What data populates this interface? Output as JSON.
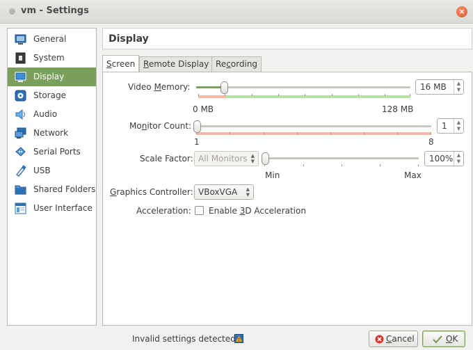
{
  "window": {
    "title": "vm - Settings"
  },
  "sidebar": {
    "items": [
      {
        "label": "General",
        "icon": "general-icon"
      },
      {
        "label": "System",
        "icon": "system-icon"
      },
      {
        "label": "Display",
        "icon": "display-icon",
        "selected": true
      },
      {
        "label": "Storage",
        "icon": "storage-icon"
      },
      {
        "label": "Audio",
        "icon": "audio-icon"
      },
      {
        "label": "Network",
        "icon": "network-icon"
      },
      {
        "label": "Serial Ports",
        "icon": "serial-ports-icon"
      },
      {
        "label": "USB",
        "icon": "usb-icon"
      },
      {
        "label": "Shared Folders",
        "icon": "shared-folders-icon"
      },
      {
        "label": "User Interface",
        "icon": "user-interface-icon"
      }
    ]
  },
  "page": {
    "title": "Display"
  },
  "tabs": {
    "screen": {
      "mnemonic": "S",
      "rest": "creen"
    },
    "remote": {
      "mnemonic": "R",
      "rest": "emote Display"
    },
    "recording": {
      "pre": "Re",
      "mnemonic": "c",
      "rest": "ording"
    }
  },
  "video_memory": {
    "label_pre": "Video ",
    "label_mnemonic": "M",
    "label_rest": "emory:",
    "value": "16 MB",
    "min_label": "0 MB",
    "max_label": "128 MB",
    "level": 0.125
  },
  "monitor_count": {
    "label_pre": "Mo",
    "label_mnemonic": "n",
    "label_rest": "itor Count:",
    "value": "1",
    "min_label": "1",
    "max_label": "8",
    "level": 0
  },
  "scale_factor": {
    "label": "Scale Factor:",
    "target": "All Monitors",
    "value": "100%",
    "min_label": "Min",
    "max_label": "Max",
    "level": 0
  },
  "graphics_controller": {
    "label_mnemonic": "G",
    "label_rest": "raphics Controller:",
    "value": "VBoxVGA"
  },
  "acceleration": {
    "label": "Acceleration:",
    "checkbox_pre": "Enable ",
    "checkbox_mnemonic": "3",
    "checkbox_rest": "D Acceleration",
    "checked": false
  },
  "footer": {
    "status": "Invalid settings detected",
    "cancel": {
      "mnemonic": "C",
      "rest": "ancel"
    },
    "ok": {
      "mnemonic": "O",
      "rest": "K"
    }
  },
  "colors": {
    "accent": "#7ba05b",
    "close": "#e0582d"
  }
}
